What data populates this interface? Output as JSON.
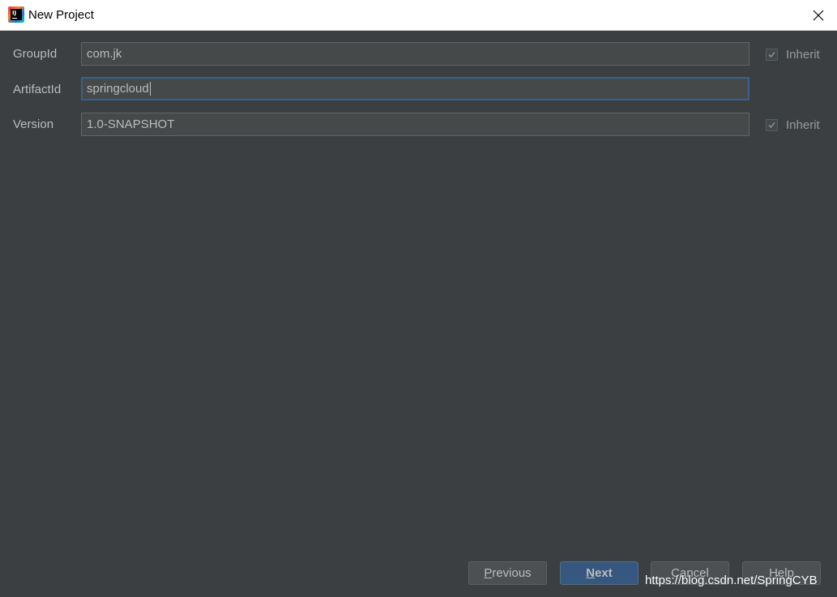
{
  "window": {
    "title": "New Project",
    "app_icon": "intellij-idea-icon",
    "close_icon": "close-icon"
  },
  "form": {
    "group_id": {
      "label": "GroupId",
      "value": "com.jk",
      "inherit_label": "Inherit",
      "inherit_checked": true
    },
    "artifact_id": {
      "label": "ArtifactId",
      "value": "springcloud"
    },
    "version": {
      "label": "Version",
      "value": "1.0-SNAPSHOT",
      "inherit_label": "Inherit",
      "inherit_checked": true
    }
  },
  "buttons": {
    "previous": {
      "mnemonic": "P",
      "rest": "revious"
    },
    "next": {
      "mnemonic": "N",
      "rest": "ext"
    },
    "cancel": "Cancel",
    "help": "Help"
  },
  "watermark": "https://blog.csdn.net/SpringCYB",
  "colors": {
    "background": "#3c3f41",
    "field_bg": "#45494a",
    "focus_border": "#3d6185",
    "default_button": "#365880"
  }
}
